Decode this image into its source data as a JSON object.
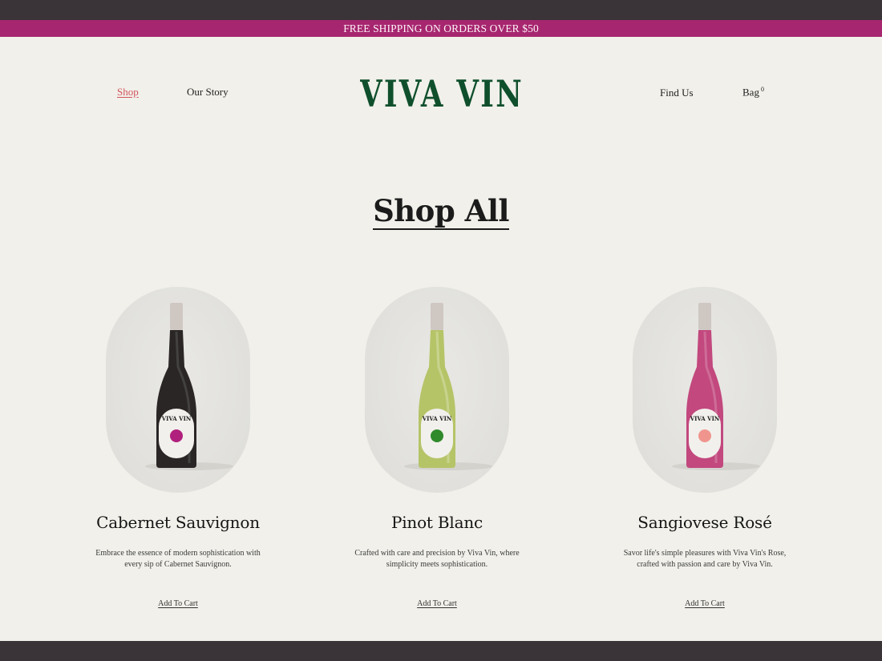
{
  "promo_banner": "FREE SHIPPING ON ORDERS OVER $50",
  "nav": {
    "shop": "Shop",
    "our_story": "Our Story",
    "find_us": "Find Us",
    "bag": "Bag",
    "bag_count": "0"
  },
  "brand": {
    "logo_text": "VIVA VIN",
    "logo_color": "#0f4f2c"
  },
  "page_title": "Shop All",
  "products": [
    {
      "name": "Cabernet Sauvignon",
      "description": "Embrace the essence of modern sophistication with every sip of Cabernet Sauvignon.",
      "cta": "Add To Cart",
      "bottle_color": "#2a2626",
      "label_dot_color": "#b0207d"
    },
    {
      "name": "Pinot Blanc",
      "description": "Crafted with care and precision by Viva Vin, where simplicity meets sophistication.",
      "cta": "Add To Cart",
      "bottle_color": "#b6c468",
      "label_dot_color": "#2f8a2b"
    },
    {
      "name": "Sangiovese Rosé",
      "description": "Savor life's simple pleasures with Viva Vin's Rose, crafted with passion and care by Viva Vin.",
      "cta": "Add To Cart",
      "bottle_color": "#c2487e",
      "label_dot_color": "#f0958e"
    }
  ],
  "colors": {
    "background": "#f1f0ea",
    "promo_bg": "#a6266f",
    "active_link": "#d2525b",
    "frame_dark": "#3a3337"
  }
}
